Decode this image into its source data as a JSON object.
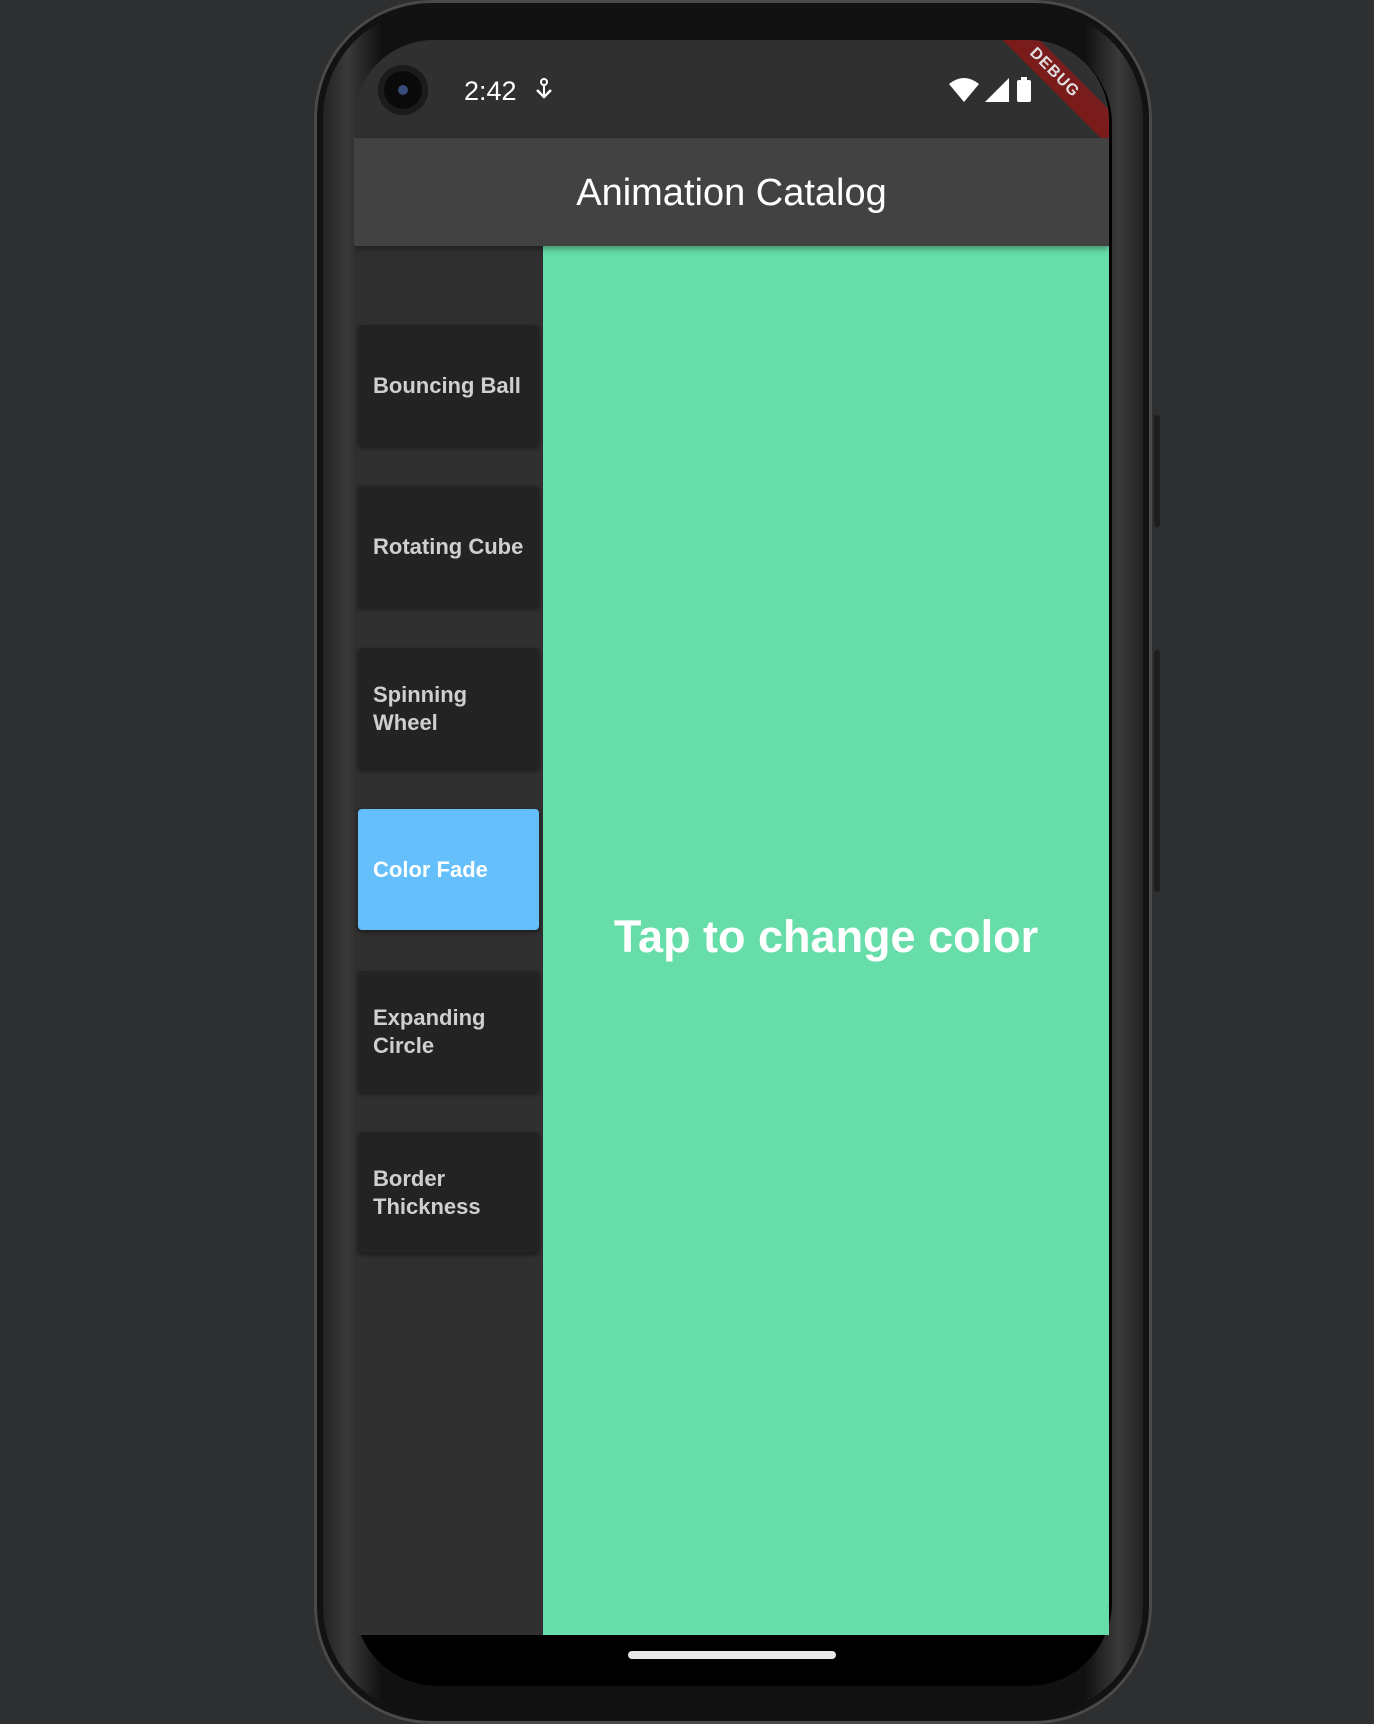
{
  "status_bar": {
    "time": "2:42",
    "debug_ribbon": "DEBUG"
  },
  "app_bar": {
    "title": "Animation Catalog"
  },
  "sidebar": {
    "items": [
      {
        "label": "Bouncing Ball",
        "selected": false
      },
      {
        "label": "Rotating Cube",
        "selected": false
      },
      {
        "label": "Spinning Wheel",
        "selected": false
      },
      {
        "label": "Color Fade",
        "selected": true
      },
      {
        "label": "Expanding Circle",
        "selected": false
      },
      {
        "label": "Border Thickness",
        "selected": false
      }
    ]
  },
  "content": {
    "label": "Tap to change color",
    "background_color": "#67dea9"
  },
  "colors": {
    "selected_item": "#64bffa",
    "app_bar": "#424242",
    "background": "#303030"
  },
  "icons": [
    "wifi-icon",
    "cell-signal-icon",
    "battery-icon",
    "download-icon",
    "camera-icon"
  ]
}
